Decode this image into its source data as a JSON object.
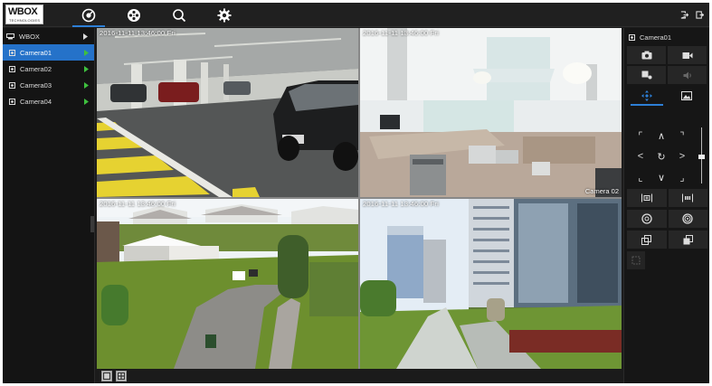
{
  "brand": {
    "logo_text": "WBOX",
    "logo_sub": "TECHNOLOGIES"
  },
  "topnav": [
    {
      "name": "live-view",
      "icon": "live-view-icon",
      "active": true
    },
    {
      "name": "playback",
      "icon": "film-reel-icon",
      "active": false
    },
    {
      "name": "search",
      "icon": "search-icon",
      "active": false
    },
    {
      "name": "settings",
      "icon": "gear-icon",
      "active": false
    }
  ],
  "topright": [
    {
      "name": "logout",
      "icon": "logout-icon"
    },
    {
      "name": "exit",
      "icon": "exit-icon"
    }
  ],
  "sidebar": {
    "root_label": "WBOX",
    "cameras": [
      {
        "label": "Camera01",
        "active": true
      },
      {
        "label": "Camera02",
        "active": false
      },
      {
        "label": "Camera03",
        "active": false
      },
      {
        "label": "Camera04",
        "active": false
      }
    ]
  },
  "tiles": [
    {
      "osd": "2016-11-11  13:46:00  Fri",
      "label": ""
    },
    {
      "osd": "2016-11-11  13:46:00  Fri",
      "label": "Camera 02"
    },
    {
      "osd": "2016-11-11  13:46:00  Fri",
      "label": ""
    },
    {
      "osd": "2016-11-11  13:46:00  Fri",
      "label": ""
    }
  ],
  "layout_buttons": [
    {
      "name": "single-view",
      "icon": "single-layout-icon"
    },
    {
      "name": "quad-view",
      "icon": "quad-layout-icon"
    }
  ],
  "right_panel": {
    "camera_title": "Camera01",
    "top_buttons": [
      [
        "snapshot-icon",
        "record-icon"
      ],
      [
        "talk-icon",
        "speaker-icon"
      ]
    ],
    "tabs": [
      {
        "icon": "ptz-move-icon",
        "active": true
      },
      {
        "icon": "image-icon",
        "active": false
      }
    ],
    "ptz_glyphs": [
      "⌜",
      "∧",
      "⌝",
      "<",
      "↻",
      ">",
      "⌞",
      "∨",
      "⌟"
    ],
    "lower_buttons": [
      [
        "zoom-in-icon",
        "zoom-out-icon"
      ],
      [
        "focus-near-icon",
        "focus-far-icon"
      ],
      [
        "iris-open-icon",
        "iris-close-icon"
      ]
    ]
  },
  "colors": {
    "accent": "#2572c9",
    "background": "#1b1b1b",
    "play": "#3ec03e"
  }
}
